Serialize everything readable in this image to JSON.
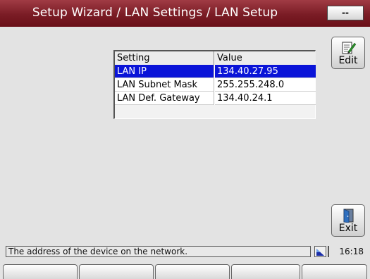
{
  "title": "Setup Wizard / LAN Settings / LAN Setup",
  "title_badge": "--",
  "table": {
    "headers": [
      "Setting",
      "Value"
    ],
    "rows": [
      {
        "setting": "LAN IP",
        "value": "134.40.27.95",
        "selected": true
      },
      {
        "setting": "LAN Subnet Mask",
        "value": "255.255.248.0",
        "selected": false
      },
      {
        "setting": "LAN Def. Gateway",
        "value": "134.40.24.1",
        "selected": false
      }
    ]
  },
  "buttons": {
    "edit": {
      "label": "Edit",
      "icon": "edit-icon"
    },
    "exit": {
      "label": "Exit",
      "icon": "exit-door-icon"
    }
  },
  "status": {
    "message": "The address of the device on the network.",
    "icon": "network-status-icon",
    "time": "16:18"
  },
  "softkeys": [
    "",
    "",
    "",
    "",
    ""
  ],
  "colors": {
    "titlebar": "#7a1c25",
    "selection": "#0a14d8",
    "background": "#e3e3e3"
  }
}
